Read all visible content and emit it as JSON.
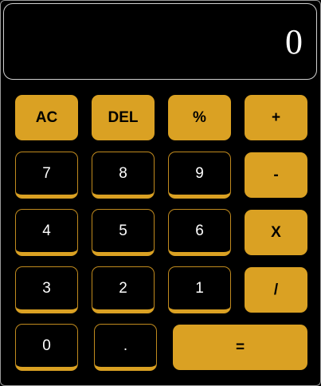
{
  "display": {
    "value": "0"
  },
  "keys": {
    "ac": "AC",
    "del": "DEL",
    "percent": "%",
    "plus": "+",
    "seven": "7",
    "eight": "8",
    "nine": "9",
    "minus": "-",
    "four": "4",
    "five": "5",
    "six": "6",
    "multiply": "X",
    "three": "3",
    "two": "2",
    "one": "1",
    "divide": "/",
    "zero": "0",
    "decimal": ".",
    "equals": "="
  },
  "colors": {
    "background": "#000000",
    "accent": "#daa123",
    "text": "#ffffff"
  }
}
